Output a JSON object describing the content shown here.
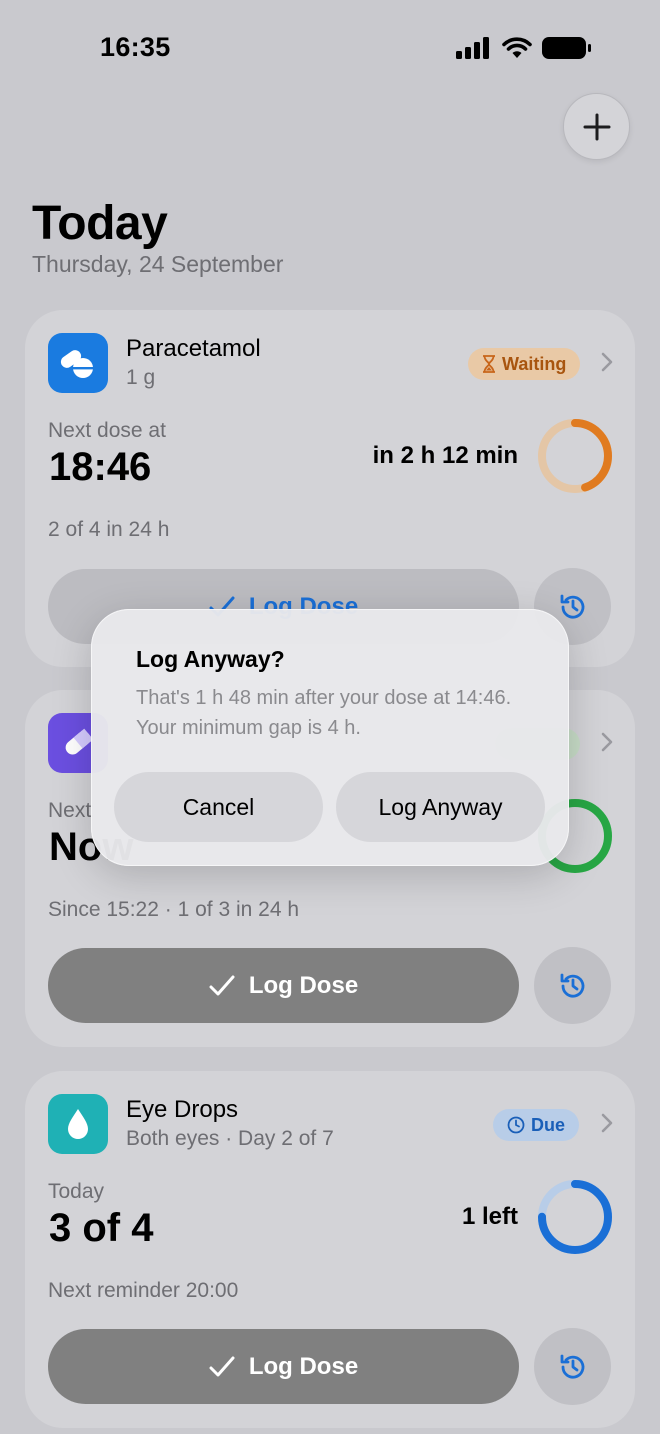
{
  "status_bar": {
    "time": "16:35"
  },
  "header": {
    "title": "Today",
    "date": "Thursday, 24 September"
  },
  "cards": [
    {
      "name": "Paracetamol",
      "subtitle": "1 g",
      "badge": "Waiting",
      "badge_color": "#e07b20",
      "label": "Next dose at",
      "value": "18:46",
      "relative": "in 2 h 12 min",
      "meta": "2 of 4 in 24 h",
      "log_label": "Log Dose",
      "ring_color": "#e07b20",
      "ring_progress": 0.45
    },
    {
      "label_partial": "Next",
      "value_partial": "Now",
      "meta": "Since 15:22 · 1 of 3 in 24 h",
      "log_label": "Log Dose",
      "ring_color": "#28a745",
      "ring_progress": 1.0
    },
    {
      "name": "Eye Drops",
      "subtitle": "Both eyes · Day 2 of 7",
      "badge": "Due",
      "badge_color": "#1a6fd6",
      "label": "Today",
      "value": "3 of 4",
      "relative": "1 left",
      "meta": "Next reminder 20:00",
      "log_label": "Log Dose",
      "ring_color": "#1a6fd6",
      "ring_progress": 0.75
    }
  ],
  "dialog": {
    "title": "Log Anyway?",
    "message": "That's 1 h 48 min after your dose at 14:46. Your minimum gap is 4 h.",
    "cancel_label": "Cancel",
    "confirm_label": "Log Anyway"
  },
  "colors": {
    "accent_blue": "#1a6fd6",
    "accent_orange": "#e07b20",
    "accent_green": "#28a745",
    "accent_purple": "#6b4fe0"
  }
}
